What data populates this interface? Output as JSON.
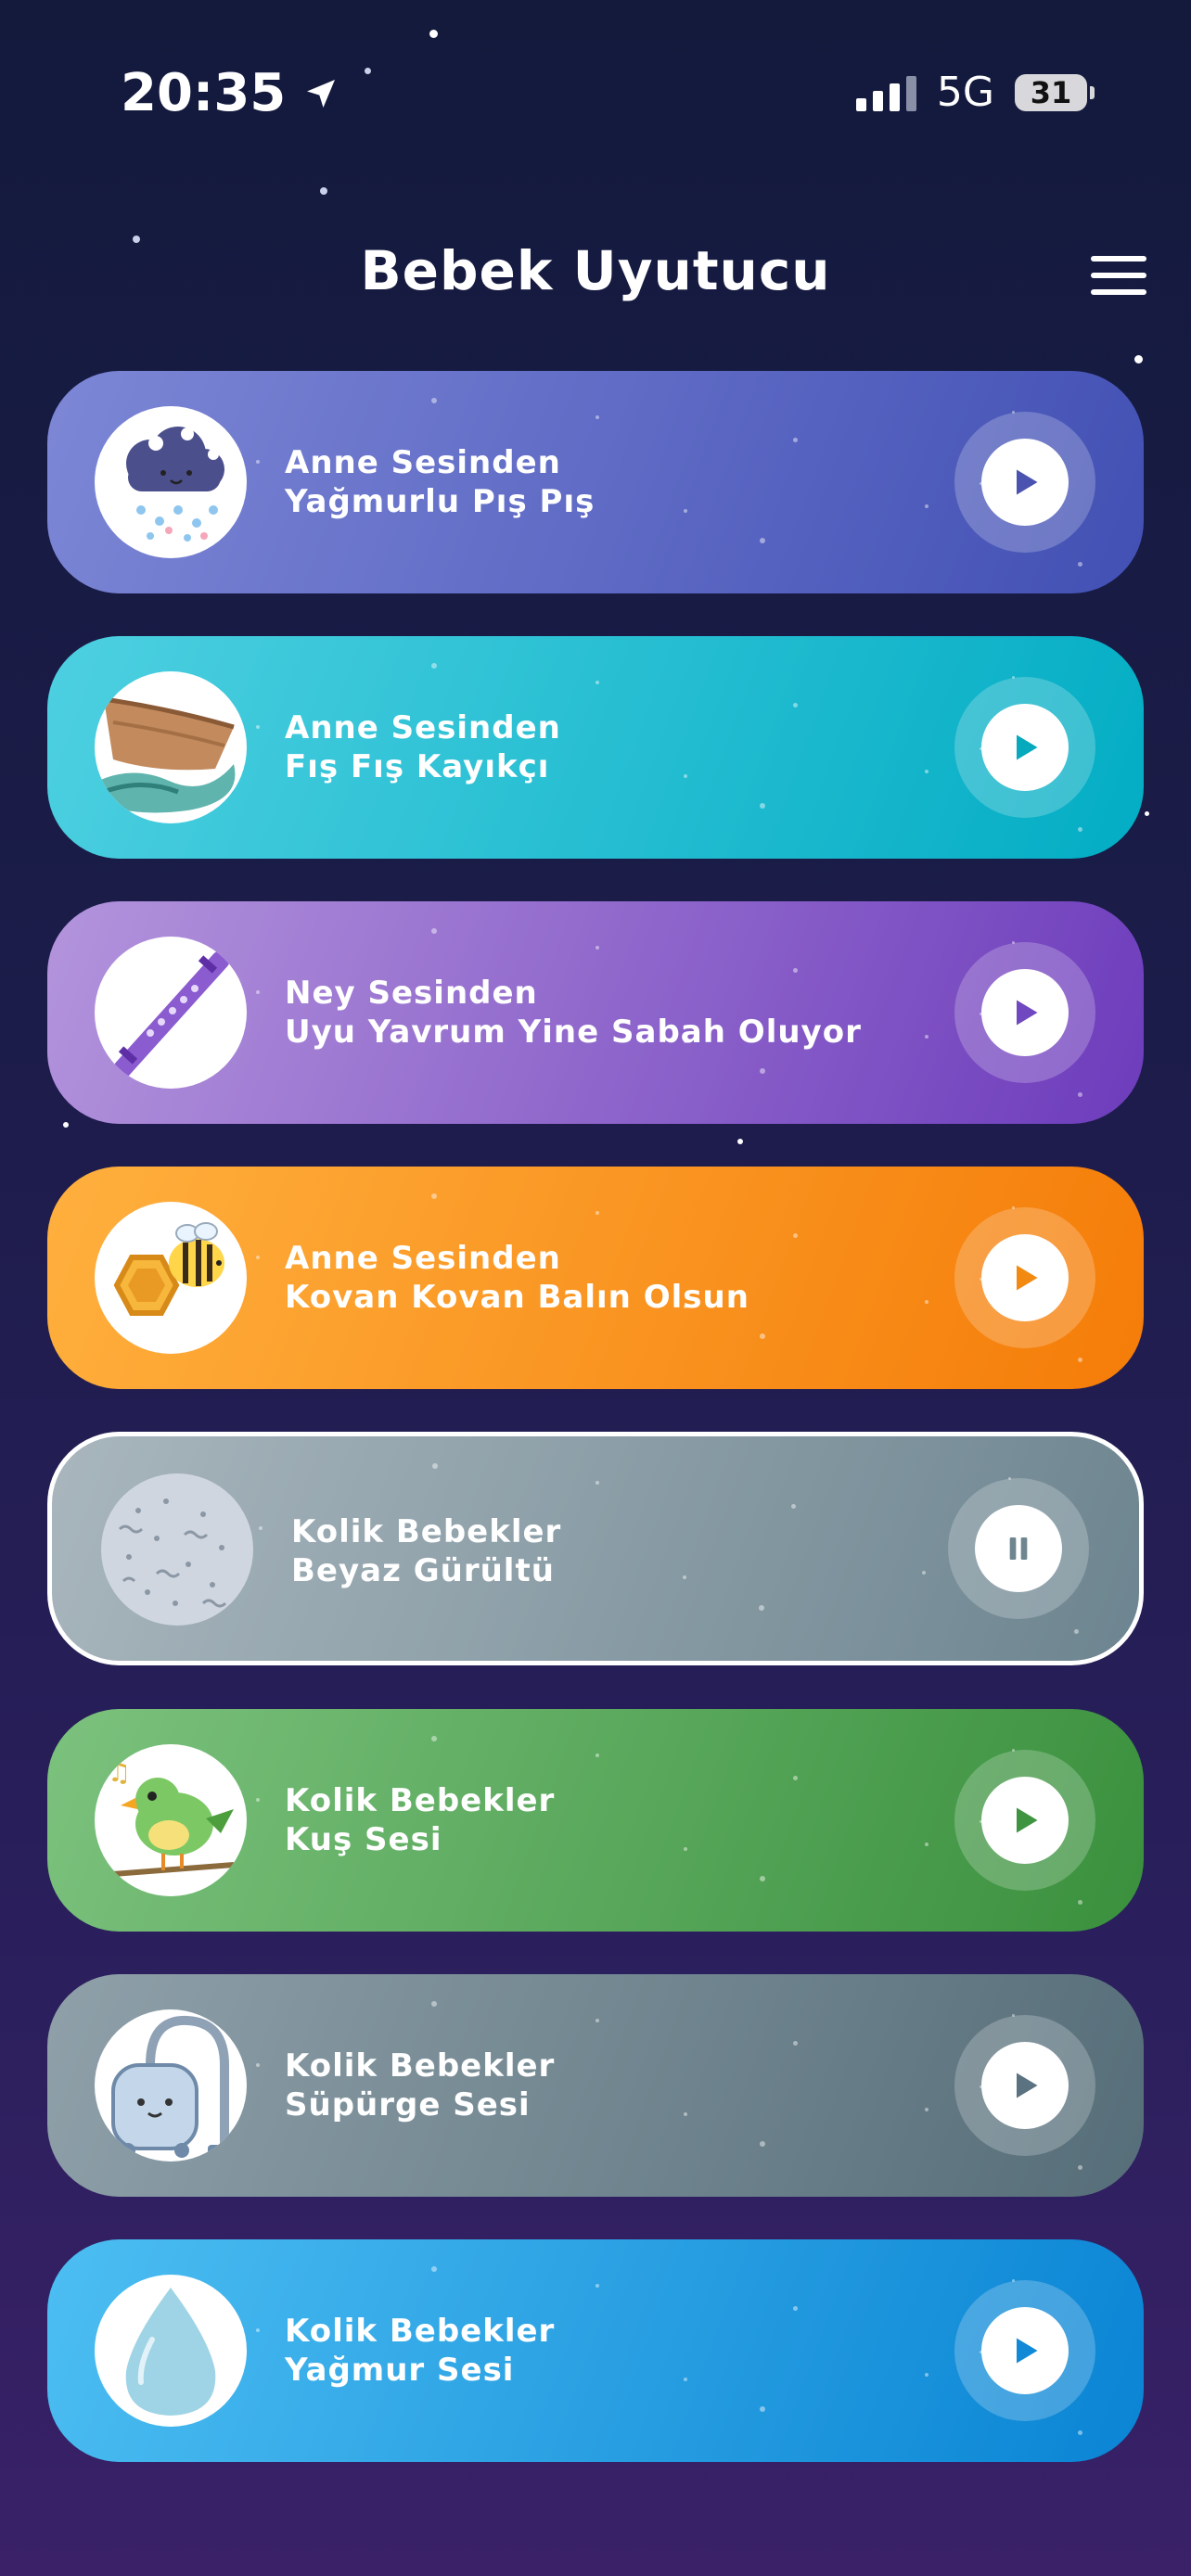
{
  "status_bar": {
    "time": "20:35",
    "network": "5G",
    "battery": "31"
  },
  "header": {
    "title": "Bebek Uyutucu"
  },
  "tracks": [
    {
      "line1": "Anne Sesinden",
      "line2": "Yağmurlu Pış Pış",
      "state": "play",
      "thumb": "rain-cloud-icon",
      "colors": [
        "#7d87d6",
        "#4250b4"
      ],
      "icon_color": "#4a53b0"
    },
    {
      "line1": "Anne Sesinden",
      "line2": "Fış Fış Kayıkçı",
      "state": "play",
      "thumb": "boat-icon",
      "colors": [
        "#4dd0e1",
        "#03adc4"
      ],
      "icon_color": "#07a9bd"
    },
    {
      "line1": "Ney Sesinden",
      "line2": "Uyu Yavrum Yine Sabah Oluyor",
      "state": "play",
      "thumb": "ney-flute-icon",
      "colors": [
        "#b394dc",
        "#6d3cbc"
      ],
      "icon_color": "#7048bf"
    },
    {
      "line1": "Anne Sesinden",
      "line2": "Kovan Kovan Balın Olsun",
      "state": "play",
      "thumb": "bee-honeycomb-icon",
      "colors": [
        "#ffb03e",
        "#f57c08"
      ],
      "icon_color": "#f28a12"
    },
    {
      "line1": "Kolik Bebekler",
      "line2": "Beyaz Gürültü",
      "state": "pause",
      "thumb": "white-noise-icon",
      "colors": [
        "#a9b6bd",
        "#6d8590"
      ],
      "icon_color": "#6f8690"
    },
    {
      "line1": "Kolik Bebekler",
      "line2": "Kuş Sesi",
      "state": "play",
      "thumb": "bird-icon",
      "colors": [
        "#7cc27e",
        "#3a903d"
      ],
      "icon_color": "#3f9442"
    },
    {
      "line1": "Kolik Bebekler",
      "line2": "Süpürge Sesi",
      "state": "play",
      "thumb": "vacuum-cleaner-icon",
      "colors": [
        "#8fa0a9",
        "#566e79"
      ],
      "icon_color": "#5b7380"
    },
    {
      "line1": "Kolik Bebekler",
      "line2": "Yağmur Sesi",
      "state": "play",
      "thumb": "water-drop-icon",
      "colors": [
        "#4cbef2",
        "#0a84d4"
      ],
      "icon_color": "#1189d6"
    }
  ]
}
